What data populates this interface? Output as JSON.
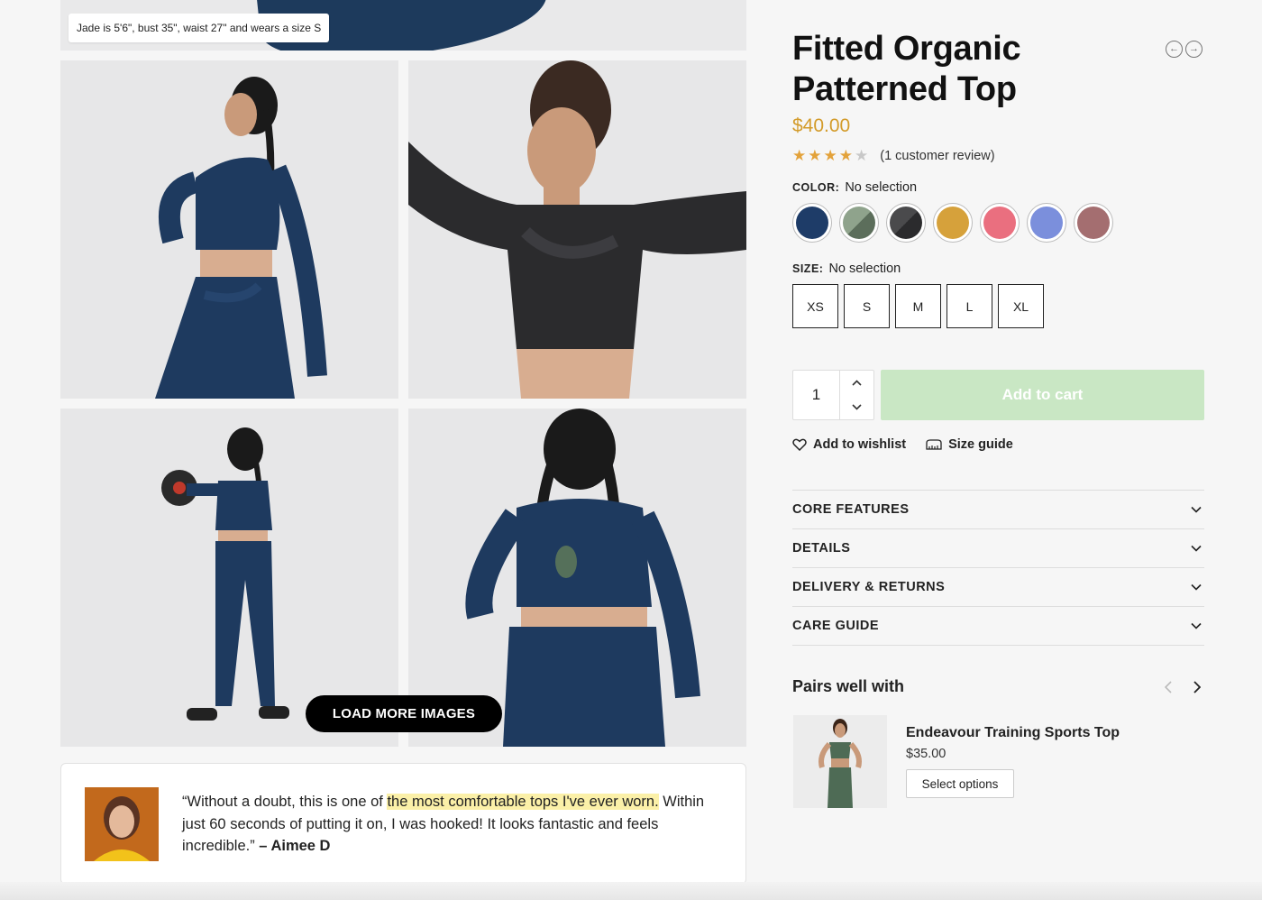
{
  "gallery": {
    "model_note": "Jade is 5'6\", bust 35\", waist 27\" and wears a size S",
    "load_more_label": "LOAD MORE IMAGES"
  },
  "testimonial": {
    "quote_before": "“Without a doubt, this is one of ",
    "quote_highlight": "the most comfortable tops I've ever worn.",
    "quote_after": " Within just 60 seconds of putting it on, I was hooked! It looks fantastic and feels incredible.” ",
    "author": "– Aimee D"
  },
  "product": {
    "title": "Fitted Organic Patterned Top",
    "price": "$40.00",
    "rating": 4,
    "rating_max": 5,
    "review_count": "(1 customer review)",
    "color_label": "COLOR:",
    "color_value": "No selection",
    "colors": [
      "navy",
      "sage",
      "charcoal",
      "mustard",
      "coral",
      "periwinkle",
      "mauve"
    ],
    "size_label": "SIZE:",
    "size_value": "No selection",
    "sizes": [
      "XS",
      "S",
      "M",
      "L",
      "XL"
    ],
    "quantity": "1",
    "add_to_cart": "Add to cart",
    "wishlist": "Add to wishlist",
    "size_guide": "Size guide",
    "accordion": [
      "CORE FEATURES",
      "DETAILS",
      "DELIVERY & RETURNS",
      "CARE GUIDE"
    ]
  },
  "pairs": {
    "title": "Pairs well with",
    "item_name": "Endeavour Training Sports Top",
    "item_price": "$35.00",
    "item_button": "Select options"
  },
  "colors": {
    "accent_price": "#d39b2a",
    "star": "#e3a23a",
    "add_to_cart_bg": "#c9e7c4",
    "highlight": "#fbf0a8"
  }
}
